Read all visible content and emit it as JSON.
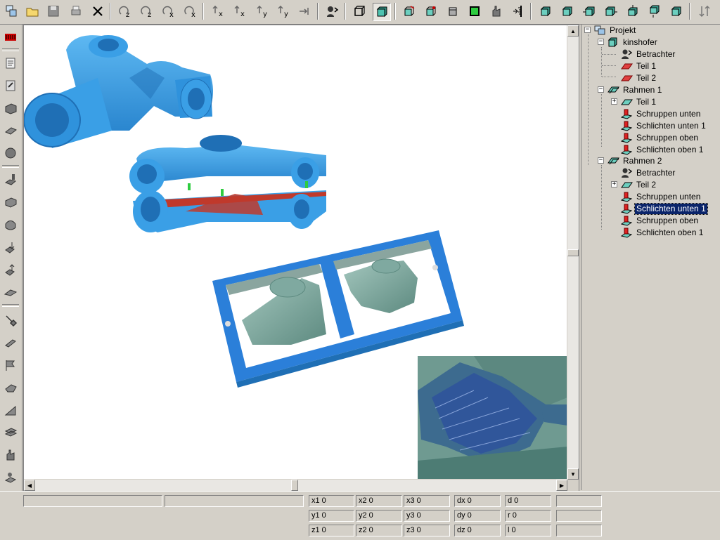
{
  "toolbar": {
    "buttons": [
      {
        "name": "project-icon"
      },
      {
        "name": "open-folder-icon"
      },
      {
        "name": "save-icon"
      },
      {
        "name": "print-icon"
      },
      {
        "name": "delete-icon"
      },
      {
        "name": "rotate-z-plus-icon",
        "axis": "z"
      },
      {
        "name": "rotate-z-minus-icon",
        "axis": "z"
      },
      {
        "name": "rotate-x-plus-icon",
        "axis": "x"
      },
      {
        "name": "rotate-x-minus-icon",
        "axis": "x"
      },
      {
        "name": "move-x-plus-icon",
        "axis": "x"
      },
      {
        "name": "move-x-minus-icon",
        "axis": "x"
      },
      {
        "name": "move-y-plus-icon",
        "axis": "y"
      },
      {
        "name": "move-y-minus-icon",
        "axis": "y"
      },
      {
        "name": "move-end-icon",
        "axis": ""
      },
      {
        "name": "viewer-icon"
      },
      {
        "name": "wireframe-view-icon"
      },
      {
        "name": "shaded-view-icon"
      },
      {
        "name": "view-iso-icon"
      },
      {
        "name": "view-front-icon"
      },
      {
        "name": "view-side-icon"
      },
      {
        "name": "render-icon"
      },
      {
        "name": "hand-icon"
      },
      {
        "name": "ruler-icon"
      },
      {
        "name": "cube-view-1-icon"
      },
      {
        "name": "cube-view-2-icon"
      },
      {
        "name": "cube-view-3-icon"
      },
      {
        "name": "cube-view-4-icon"
      },
      {
        "name": "cube-view-5-icon"
      },
      {
        "name": "cube-view-6-icon"
      },
      {
        "name": "cube-view-7-icon"
      },
      {
        "name": "sort-icon"
      }
    ]
  },
  "left_toolbar": {
    "buttons": [
      {
        "name": "machine-icon"
      },
      {
        "name": "document-icon"
      },
      {
        "name": "edit-document-icon"
      },
      {
        "name": "block-icon"
      },
      {
        "name": "layer-icon"
      },
      {
        "name": "sphere-icon"
      },
      {
        "name": "tool-path-1-icon"
      },
      {
        "name": "surface-1-icon"
      },
      {
        "name": "surface-2-icon"
      },
      {
        "name": "tool-path-2-icon"
      },
      {
        "name": "tool-path-3-icon"
      },
      {
        "name": "plane-icon"
      },
      {
        "name": "milling-tool-icon"
      },
      {
        "name": "cut-icon"
      },
      {
        "name": "flag-icon"
      },
      {
        "name": "surface-3-icon"
      },
      {
        "name": "slope-icon"
      },
      {
        "name": "layers-icon"
      },
      {
        "name": "hand-tool-icon"
      },
      {
        "name": "simulation-1-icon"
      },
      {
        "name": "simulation-2-icon"
      }
    ]
  },
  "tree": {
    "items": [
      {
        "label": "Projekt",
        "icon": "project-icon",
        "level": 0,
        "expander": "-"
      },
      {
        "label": "kinshofer",
        "icon": "part-cube-icon",
        "level": 1,
        "expander": "-"
      },
      {
        "label": "Betrachter",
        "icon": "viewer-icon",
        "level": 2,
        "expander": ""
      },
      {
        "label": "Teil 1",
        "icon": "red-plane-icon",
        "level": 2,
        "expander": ""
      },
      {
        "label": "Teil 2",
        "icon": "red-plane-icon",
        "level": 2,
        "expander": ""
      },
      {
        "label": "Rahmen 1",
        "icon": "frame-icon",
        "level": 1,
        "expander": "-"
      },
      {
        "label": "Teil 1",
        "icon": "cyan-plane-icon",
        "level": 2,
        "expander": "+"
      },
      {
        "label": "Schruppen unten",
        "icon": "operation-icon",
        "level": 2,
        "expander": ""
      },
      {
        "label": "Schlichten unten 1",
        "icon": "operation-icon",
        "level": 2,
        "expander": ""
      },
      {
        "label": "Schruppen oben",
        "icon": "operation-icon",
        "level": 2,
        "expander": ""
      },
      {
        "label": "Schlichten oben 1",
        "icon": "operation-icon",
        "level": 2,
        "expander": ""
      },
      {
        "label": "Rahmen 2",
        "icon": "frame-icon",
        "level": 1,
        "expander": "-"
      },
      {
        "label": "Betrachter",
        "icon": "viewer-icon",
        "level": 2,
        "expander": ""
      },
      {
        "label": "Teil 2",
        "icon": "cyan-plane-icon",
        "level": 2,
        "expander": "+"
      },
      {
        "label": "Schruppen unten",
        "icon": "operation-icon",
        "level": 2,
        "expander": ""
      },
      {
        "label": "Schlichten unten 1",
        "icon": "operation-icon",
        "level": 2,
        "expander": "",
        "selected": true
      },
      {
        "label": "Schruppen oben",
        "icon": "operation-icon",
        "level": 2,
        "expander": ""
      },
      {
        "label": "Schlichten oben 1",
        "icon": "operation-icon",
        "level": 2,
        "expander": ""
      }
    ]
  },
  "status": {
    "message_left": "",
    "message_right": "",
    "coords": {
      "x1": "x1  0",
      "y1": "y1  0",
      "z1": "z1  0",
      "x2": "x2  0",
      "y2": "y2  0",
      "z2": "z2  0",
      "x3": "x3  0",
      "y3": "y3  0",
      "z3": "z3  0",
      "dx": "dx  0",
      "dy": "dy  0",
      "dz": "dz  0",
      "d": "d  0",
      "r": "r  0",
      "l": "l  0",
      "extra1": "",
      "extra2": "",
      "extra3": ""
    }
  },
  "colors": {
    "part_blue": "#3a9fe6",
    "part_dark_blue": "#1f6fb5",
    "frame_blue": "#2b7fd9",
    "casting_gray": "#7fa9a0",
    "cut_red": "#c0392b",
    "selection": "#0a246a"
  }
}
